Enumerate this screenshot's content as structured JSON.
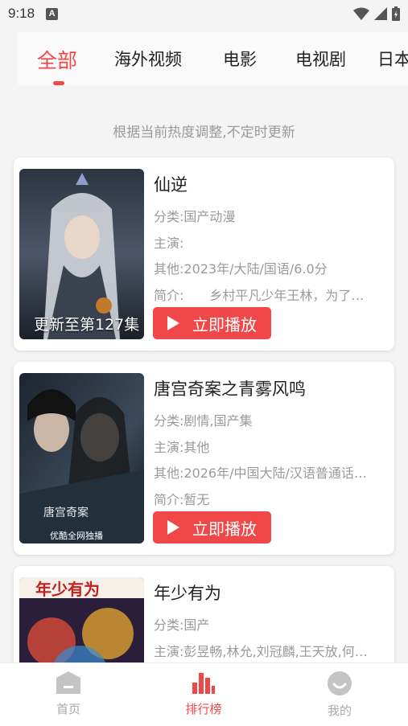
{
  "status": {
    "time": "9:18",
    "notif": "A"
  },
  "tabs": [
    "全部",
    "海外视频",
    "电影",
    "电视剧",
    "日本"
  ],
  "notice": "根据当前热度调整,不定时更新",
  "cards": [
    {
      "title": "仙逆",
      "category": "分类:国产动漫",
      "cast": "主演:",
      "other": "其他:2023年/大陆/国语/6.0分",
      "intro": "简介:　　乡村平凡少年王林，为了…",
      "overlay": "更新至第127集",
      "play": "立即播放"
    },
    {
      "title": "唐宫奇案之青雾风鸣",
      "category": "分类:剧情,国产集",
      "cast": "主演:其他",
      "other": "其他:2026年/中国大陆/汉语普通话…",
      "intro": "简介:暂无",
      "overlay": "",
      "play": "立即播放"
    },
    {
      "title": "年少有为",
      "category": "分类:国产",
      "cast": "主演:彭昱畅,林允,刘冠麟,王天放,何…",
      "other": "",
      "intro": "",
      "overlay": "",
      "play": ""
    }
  ],
  "nav": [
    {
      "label": "首页",
      "icon": "home-icon"
    },
    {
      "label": "排行榜",
      "icon": "chart-icon"
    },
    {
      "label": "我的",
      "icon": "smile-icon"
    }
  ],
  "colors": {
    "accent": "#f04848",
    "muted": "#9a9a9a"
  }
}
